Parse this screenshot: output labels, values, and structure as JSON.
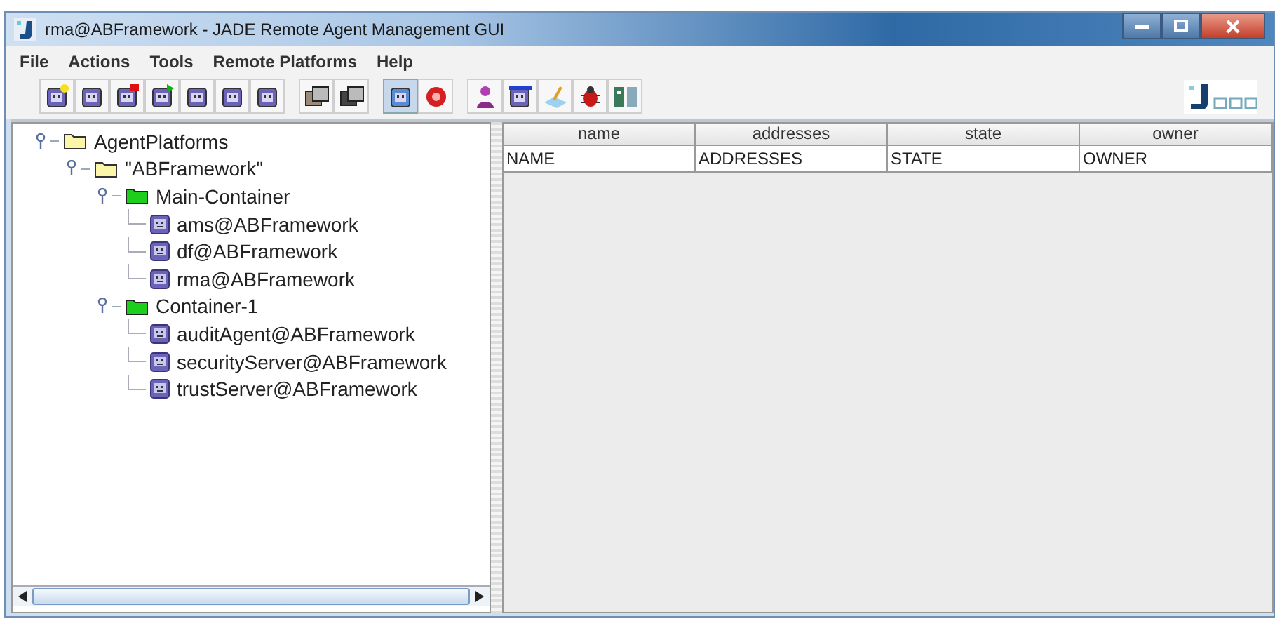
{
  "window": {
    "title": "rma@ABFramework - JADE Remote Agent Management GUI"
  },
  "menu": [
    "File",
    "Actions",
    "Tools",
    "Remote Platforms",
    "Help"
  ],
  "tree": [
    {
      "label": "AgentPlatforms",
      "kind": "folder",
      "expanded": true,
      "children": [
        {
          "label": "\"ABFramework\"",
          "kind": "folder",
          "expanded": true,
          "children": [
            {
              "label": "Main-Container",
              "kind": "container",
              "expanded": true,
              "children": [
                {
                  "label": "ams@ABFramework",
                  "kind": "agent"
                },
                {
                  "label": "df@ABFramework",
                  "kind": "agent"
                },
                {
                  "label": "rma@ABFramework",
                  "kind": "agent"
                }
              ]
            },
            {
              "label": "Container-1",
              "kind": "container",
              "expanded": true,
              "children": [
                {
                  "label": "auditAgent@ABFramework",
                  "kind": "agent"
                },
                {
                  "label": "securityServer@ABFramework",
                  "kind": "agent"
                },
                {
                  "label": "trustServer@ABFramework",
                  "kind": "agent"
                }
              ]
            }
          ]
        }
      ]
    }
  ],
  "table": {
    "columns": [
      "name",
      "addresses",
      "state",
      "owner"
    ],
    "rows": [
      [
        "NAME",
        "ADDRESSES",
        "STATE",
        "OWNER"
      ]
    ]
  }
}
